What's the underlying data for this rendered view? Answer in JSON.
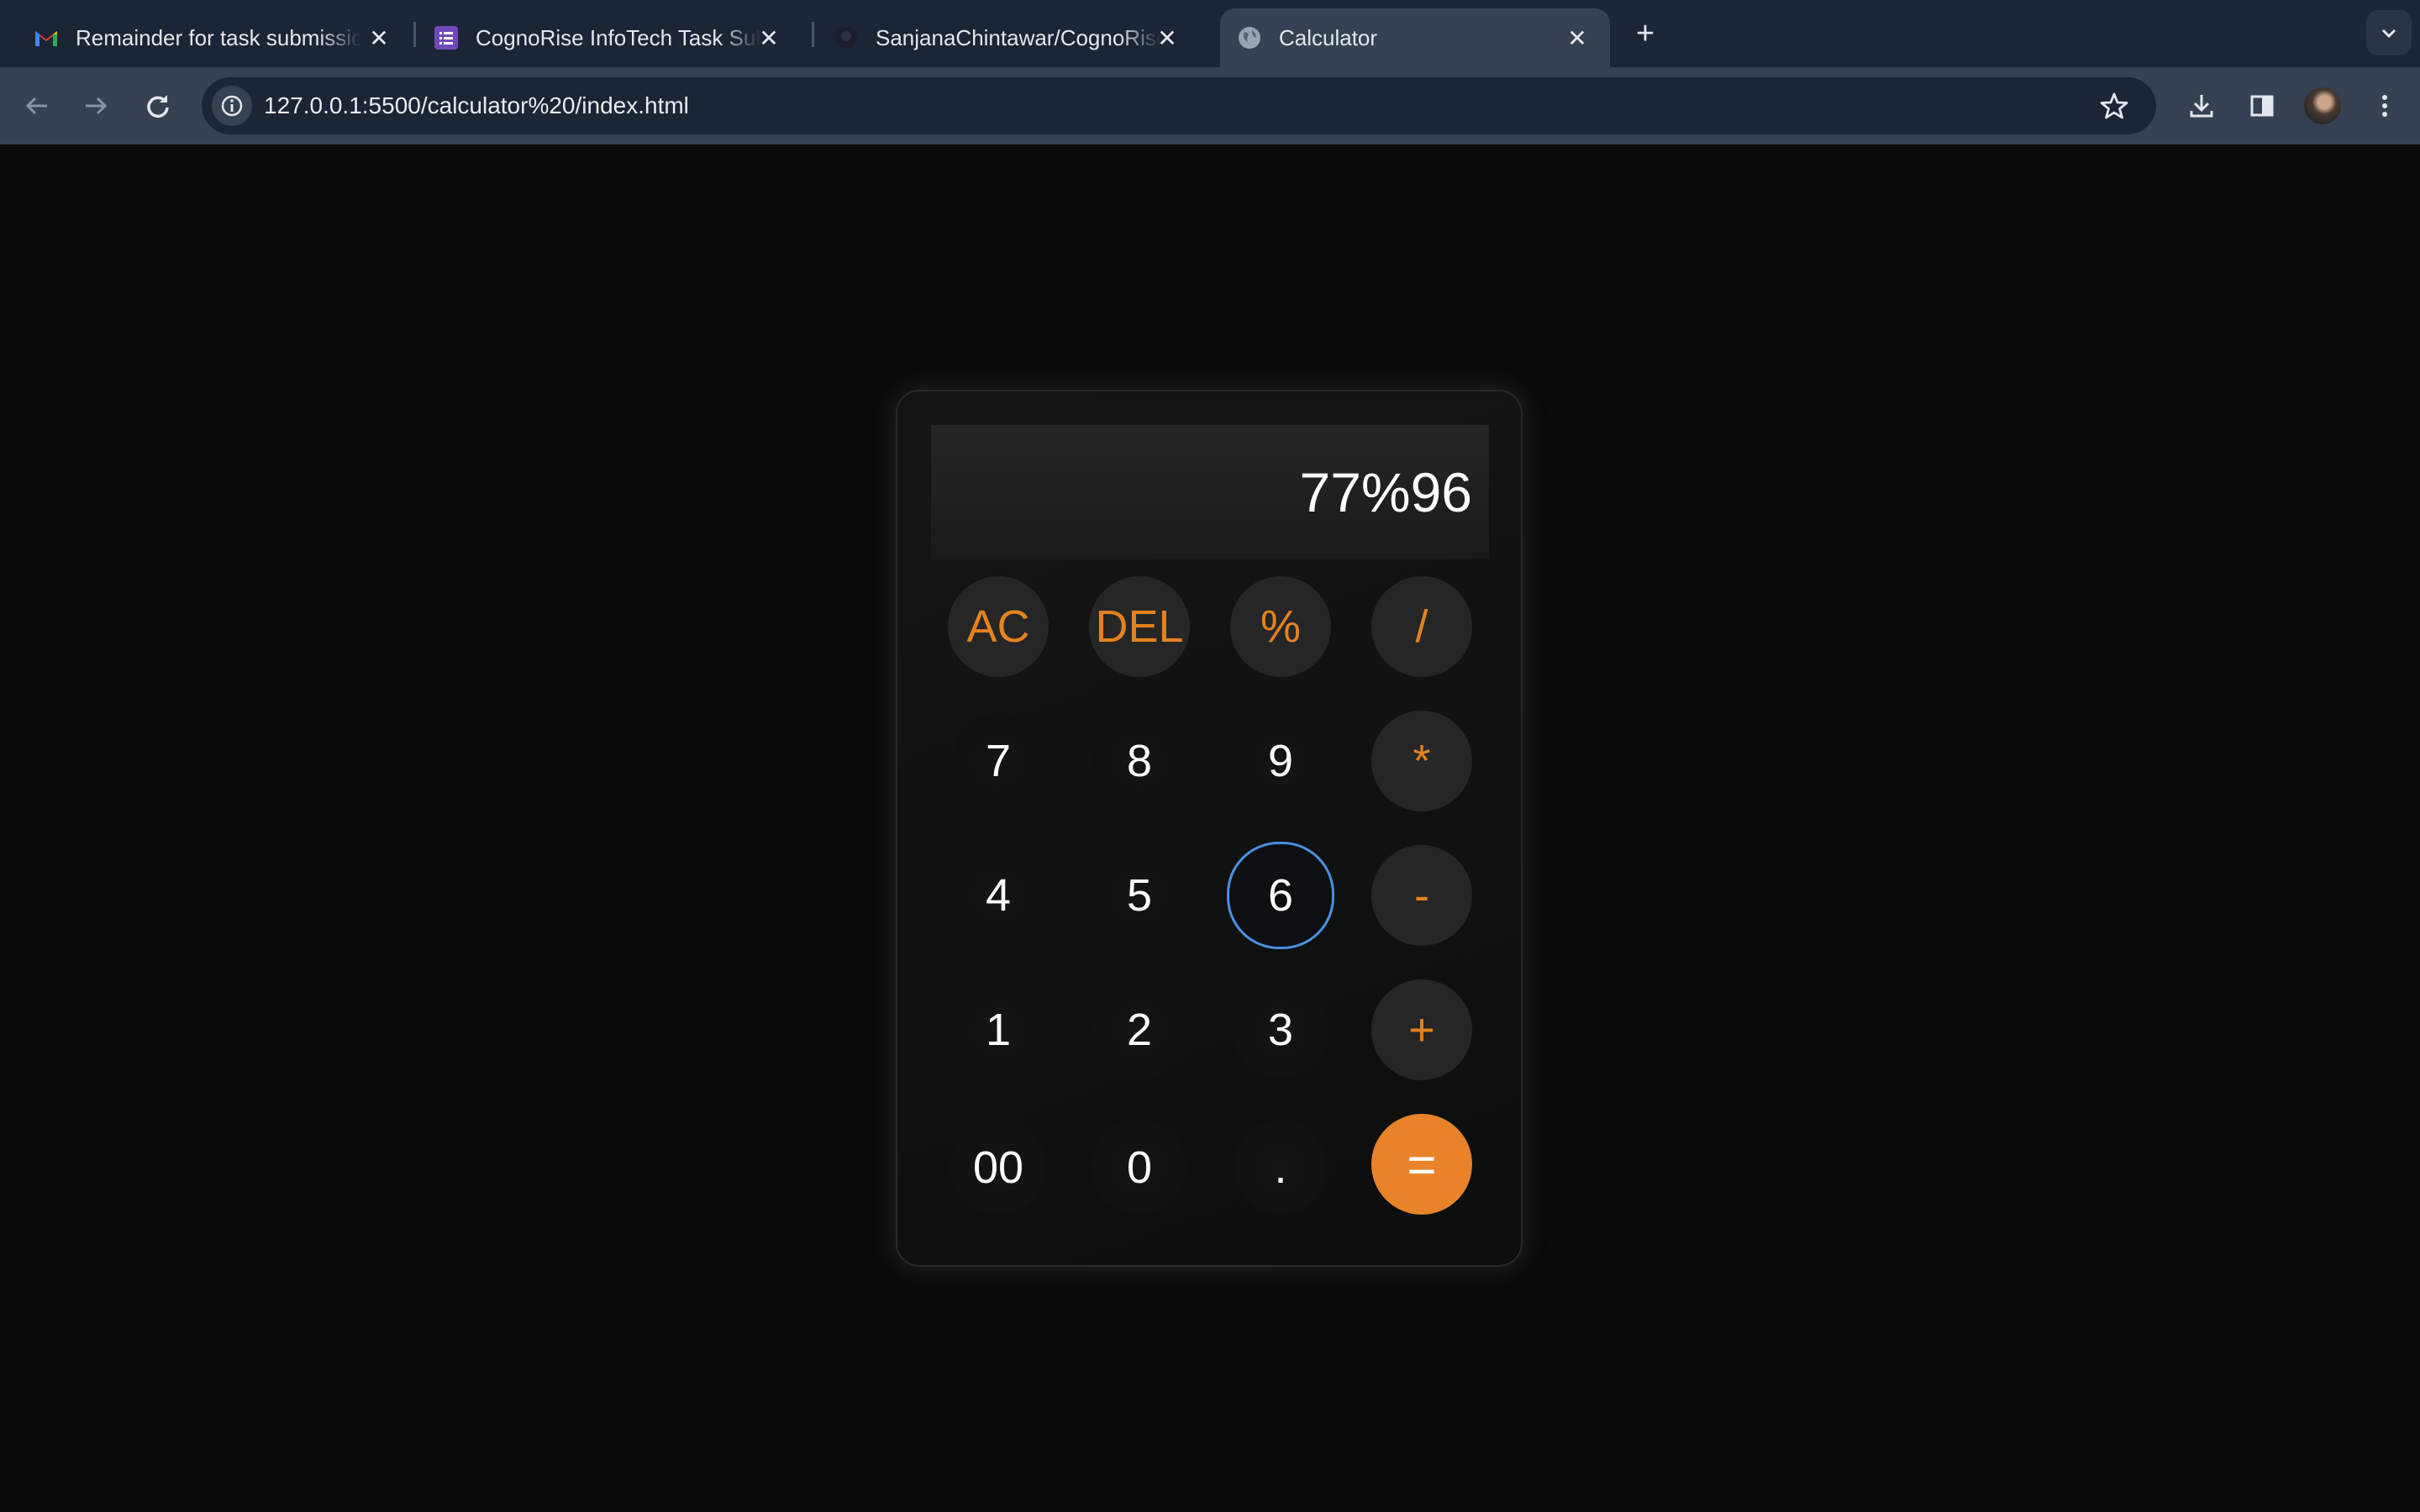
{
  "browser": {
    "tabs": [
      {
        "label": "Remainder for task submissio",
        "icon": "gmail-icon",
        "active": false
      },
      {
        "label": "CognoRise InfoTech Task Sub",
        "icon": "forms-icon",
        "active": false
      },
      {
        "label": "SanjanaChintawar/CognoRise",
        "icon": "github-icon",
        "active": false
      },
      {
        "label": "Calculator",
        "icon": "globe-icon",
        "active": true
      }
    ],
    "url": "127.0.0.1:5500/calculator%20/index.html"
  },
  "calculator": {
    "display": "77%96",
    "keys": {
      "ac": "AC",
      "del": "DEL",
      "percent": "%",
      "divide": "/",
      "seven": "7",
      "eight": "8",
      "nine": "9",
      "multiply": "*",
      "four": "4",
      "five": "5",
      "six": "6",
      "minus": "-",
      "one": "1",
      "two": "2",
      "three": "3",
      "plus": "+",
      "double_zero": "00",
      "zero": "0",
      "dot": ".",
      "equals": "="
    }
  },
  "colors": {
    "accent": "#e8832a",
    "background": "#0a0a0a",
    "focus_ring": "#4a90e2"
  }
}
